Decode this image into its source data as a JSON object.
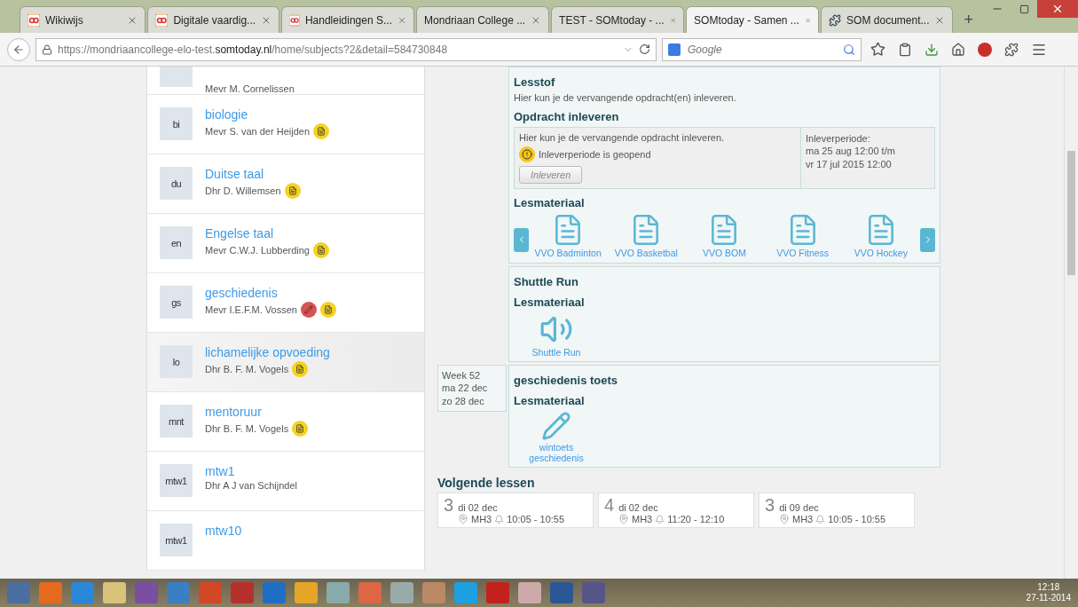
{
  "browser": {
    "tabs": [
      {
        "label": "Wikiwijs",
        "kind": "site",
        "selected": false
      },
      {
        "label": "Digitale vaardig...",
        "kind": "site",
        "selected": false
      },
      {
        "label": "Handleidingen S...",
        "kind": "site",
        "selected": false
      },
      {
        "label": "Mondriaan College ...",
        "kind": "plain",
        "selected": false
      },
      {
        "label": "TEST - SOMtoday - ...",
        "kind": "plain",
        "selected": false
      },
      {
        "label": "SOMtoday - Samen ...",
        "kind": "plain",
        "selected": true
      },
      {
        "label": "SOM document...",
        "kind": "app",
        "selected": false
      }
    ],
    "new_tab": "+",
    "url": "https://mondriaancollege-elo-test.**somtoday.nl**/home/subjects?2&detail=584730848",
    "search": {
      "placeholder": "Google"
    }
  },
  "subjects": [
    {
      "teacher": "Mevr M. Cornelissen",
      "selected": false
    },
    {
      "code": "bi",
      "name": "biologie",
      "teacher": "Mevr S. van der Heijden",
      "selected": false,
      "badges": [
        {
          "kind": "assignment"
        }
      ]
    },
    {
      "code": "du",
      "name": "Duitse taal",
      "teacher": "Dhr D. Willemsen",
      "selected": false,
      "badges": [
        {
          "kind": "assignment"
        }
      ]
    },
    {
      "code": "en",
      "name": "Engelse taal",
      "teacher": "Mevr C.W.J. Lubberding",
      "selected": false,
      "badges": [
        {
          "kind": "assignment"
        }
      ]
    },
    {
      "code": "gs",
      "name": "geschiedenis",
      "teacher": "Mevr I.E.F.M. Vossen",
      "selected": false,
      "badges": [
        {
          "kind": "edit"
        },
        {
          "kind": "assignment"
        }
      ]
    },
    {
      "code": "lo",
      "name": "lichamelijke opvoeding",
      "teacher": "Dhr B. F. M. Vogels",
      "selected": true,
      "badges": [
        {
          "kind": "assignment"
        }
      ]
    },
    {
      "code": "mnt",
      "name": "mentoruur",
      "teacher": "Dhr B. F. M. Vogels",
      "selected": false,
      "badges": [
        {
          "kind": "assignment"
        }
      ]
    },
    {
      "code": "mtw1",
      "name": "mtw1",
      "teacher": "Dhr A J van Schijndel",
      "selected": false
    },
    {
      "code": "mtw1",
      "name": "mtw10",
      "selected": false
    }
  ],
  "weeks": [
    {
      "title": "Lesstof",
      "description": "Hier kun je de vervangende opdracht(en) inleveren.",
      "assignment": {
        "heading": "Opdracht inleveren",
        "text": "Hier kun je de vervangende opdracht inleveren.",
        "status": "Inleverperiode is geopend",
        "button": "Inleveren",
        "disabled": true,
        "period": [
          "Inleverperiode:",
          "ma 25 aug 12:00 t/m",
          "vr 17 jul 2015 12:00"
        ]
      },
      "materials": {
        "heading": "Lesmateriaal",
        "carousel": true,
        "items": [
          {
            "kind": "document",
            "label": "VVO Badminton"
          },
          {
            "kind": "document",
            "label": "VVO Basketbal"
          },
          {
            "kind": "document",
            "label": "VVO BOM"
          },
          {
            "kind": "document",
            "label": "VVO Fitness"
          },
          {
            "kind": "document",
            "label": "VVO Hockey"
          }
        ]
      }
    },
    {
      "title": "Shuttle Run",
      "materials": {
        "heading": "Lesmateriaal",
        "items": [
          {
            "kind": "audio",
            "label": "Shuttle Run"
          }
        ]
      }
    },
    {
      "week": [
        "Week 52",
        "ma 22 dec",
        "zo 28 dec"
      ],
      "title": "geschiedenis toets",
      "materials": {
        "heading": "Lesmateriaal",
        "items": [
          {
            "kind": "edit",
            "label": "wintoets geschiedenis"
          }
        ]
      }
    }
  ],
  "next_lessons": {
    "heading": "Volgende lessen",
    "items": [
      {
        "hour": "3",
        "date": "di 02 dec",
        "room": "MH3",
        "time": "10:05 - 10:55"
      },
      {
        "hour": "4",
        "date": "di 02 dec",
        "room": "MH3",
        "time": "11:20 - 12:10"
      },
      {
        "hour": "3",
        "date": "di 09 dec",
        "room": "MH3",
        "time": "10:05 - 10:55"
      }
    ]
  },
  "taskbar": {
    "time": "12:18",
    "date": "27-11-2014"
  }
}
